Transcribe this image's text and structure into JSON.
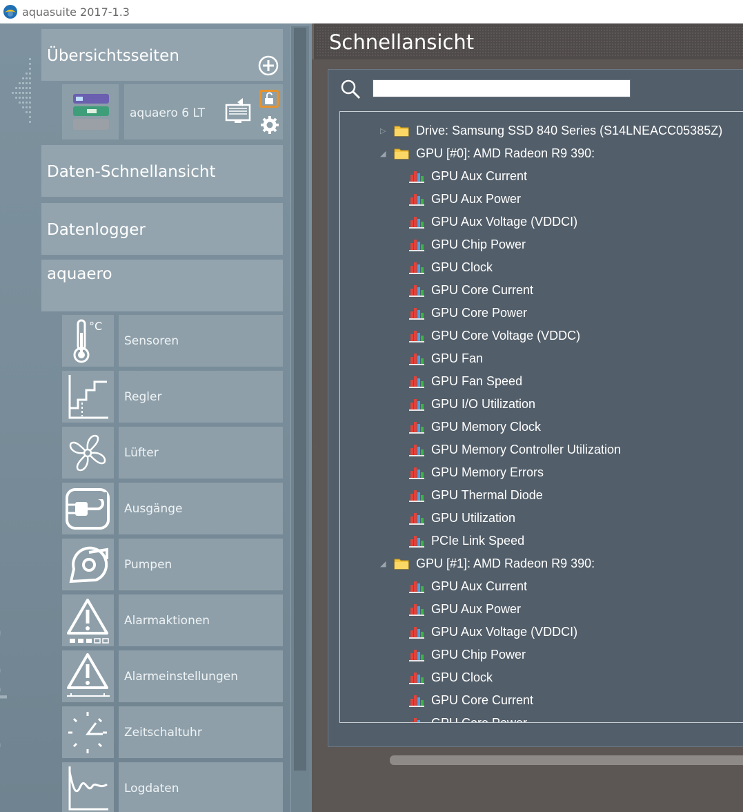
{
  "window": {
    "title": "aquasuite 2017-1.3"
  },
  "sidebar": {
    "vertical_label": "omputer",
    "overview": {
      "title": "Übersichtsseiten",
      "device_name": "aquaero 6 LT"
    },
    "quick_view_label": "Daten-Schnellansicht",
    "datalogger_label": "Datenlogger",
    "aquaero_label": "aquaero",
    "nav_items": [
      {
        "label": "Sensoren",
        "icon": "thermometer-icon"
      },
      {
        "label": "Regler",
        "icon": "controller-icon"
      },
      {
        "label": "Lüfter",
        "icon": "fan-icon"
      },
      {
        "label": "Ausgänge",
        "icon": "plug-icon"
      },
      {
        "label": "Pumpen",
        "icon": "pump-icon"
      },
      {
        "label": "Alarmaktionen",
        "icon": "alarm-actions-icon"
      },
      {
        "label": "Alarmeinstellungen",
        "icon": "alarm-settings-icon"
      },
      {
        "label": "Zeitschaltuhr",
        "icon": "clock-icon"
      },
      {
        "label": "Logdaten",
        "icon": "log-chart-icon"
      }
    ]
  },
  "main": {
    "header": "Schnellansicht",
    "search": {
      "value": "",
      "placeholder": ""
    },
    "tree": {
      "drive": "Drive: Samsung SSD 840 Series (S14LNEACC05385Z)",
      "gpu0": {
        "label": "GPU [#0]: AMD Radeon R9 390:",
        "sensors": [
          "GPU Aux Current",
          "GPU Aux Power",
          "GPU Aux Voltage (VDDCI)",
          "GPU Chip Power",
          "GPU Clock",
          "GPU Core Current",
          "GPU Core Power",
          "GPU Core Voltage (VDDC)",
          "GPU Fan",
          "GPU Fan Speed",
          "GPU I/O Utilization",
          "GPU Memory Clock",
          "GPU Memory Controller Utilization",
          "GPU Memory Errors",
          "GPU Thermal Diode",
          "GPU Utilization",
          "PCIe Link Speed"
        ]
      },
      "gpu1": {
        "label": "GPU [#1]: AMD Radeon R9 390:",
        "sensors": [
          "GPU Aux Current",
          "GPU Aux Power",
          "GPU Aux Voltage (VDDCI)",
          "GPU Chip Power",
          "GPU Clock",
          "GPU Core Current",
          "GPU Core Power"
        ]
      }
    }
  },
  "colors": {
    "sidebar_tile": "#93a4ae",
    "panel": "#525e69",
    "accent_lock": "#e8922a",
    "folder": "#f5c542"
  }
}
